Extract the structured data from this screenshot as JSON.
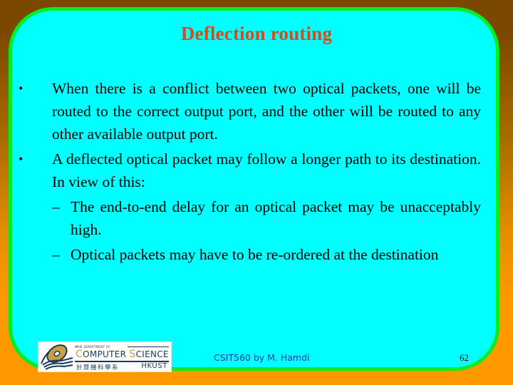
{
  "slide": {
    "title": "Deflection routing",
    "bullets": [
      {
        "text": "When there is a conflict between two optical packets, one will be routed to the correct output port, and the other will be routed to any other available output port."
      },
      {
        "text": "A deflected optical packet may follow a longer path to its destination. In view of this:",
        "subitems": [
          "The end-to-end delay for an optical packet may be unacceptably high.",
          "Optical packets may have to be re-ordered at the destination"
        ]
      }
    ],
    "bullet_glyph": "•",
    "dash_glyph": "–"
  },
  "footer": {
    "logo": {
      "dept_label": "THE DEPARTMENT OF",
      "name_c": "C",
      "name_omputer": "OMPUTER ",
      "name_s": "S",
      "name_cience": "CIENCE",
      "chinese": "計算機科學系",
      "university": "HKUST"
    },
    "course": "CSIT560 by M. Hamdi",
    "page_number": "62"
  },
  "colors": {
    "panel": "#00ffff",
    "panel_border": "#00ee22",
    "title": "#d94a1a",
    "footer_text": "#1a3ab8"
  }
}
